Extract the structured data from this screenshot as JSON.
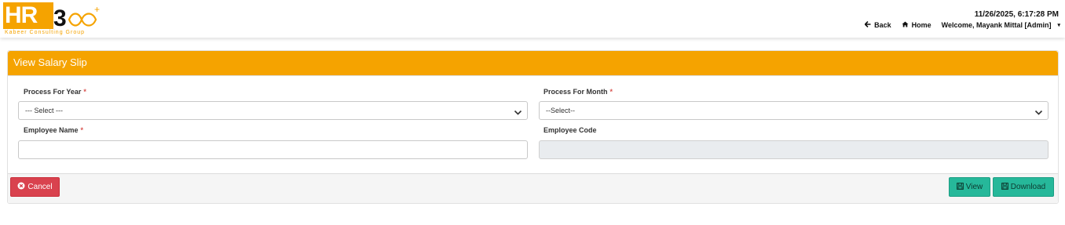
{
  "header": {
    "logo_text": "HR",
    "logo_sub": "Kabeer Consulting Group",
    "datetime": "11/26/2025, 6:17:28 PM",
    "nav": {
      "back": "Back",
      "home": "Home",
      "welcome": "Welcome, Mayank Mittal [Admin]"
    }
  },
  "panel": {
    "title": "View Salary Slip",
    "fields": {
      "year_label": "Process For Year",
      "year_value": "--- Select ---",
      "month_label": "Process For Month",
      "month_value": "--Select--",
      "employee_name_label": "Employee Name",
      "employee_name_value": "",
      "employee_code_label": "Employee Code",
      "employee_code_value": ""
    },
    "required_marker": "*"
  },
  "buttons": {
    "cancel": "Cancel",
    "view": "View",
    "download": "Download"
  },
  "colors": {
    "brand": "#f5a300",
    "cancel": "#d9424e",
    "action": "#26b89a",
    "required": "#d9534f"
  }
}
